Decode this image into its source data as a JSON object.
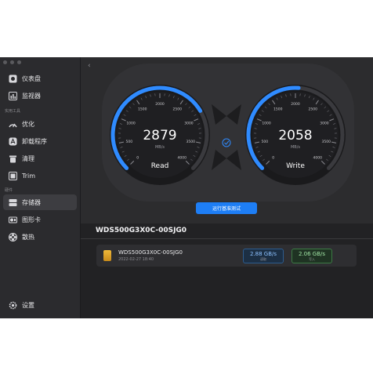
{
  "sidebar": {
    "items": [
      {
        "label": "仪表盘",
        "icon": "dashboard-icon"
      },
      {
        "label": "监视器",
        "icon": "monitor-icon"
      }
    ],
    "section_tools": "实用工具",
    "tools": [
      {
        "label": "优化",
        "icon": "optimize-icon"
      },
      {
        "label": "卸载程序",
        "icon": "uninstall-icon"
      },
      {
        "label": "清理",
        "icon": "trash-icon"
      },
      {
        "label": "Trim",
        "icon": "trim-icon"
      }
    ],
    "section_hardware": "硬件",
    "hardware": [
      {
        "label": "存储器",
        "icon": "storage-icon",
        "active": true
      },
      {
        "label": "图形卡",
        "icon": "gpu-icon"
      },
      {
        "label": "散热",
        "icon": "fan-icon"
      }
    ],
    "settings": {
      "label": "设置",
      "icon": "gear-icon"
    }
  },
  "main": {
    "back_symbol": "‹",
    "read": {
      "value": "2879",
      "unit": "MB/s",
      "label": "Read",
      "ticks": [
        "0",
        "500",
        "1000",
        "1500",
        "2000",
        "2500",
        "3000",
        "3500",
        "4000"
      ],
      "max": 4000
    },
    "write": {
      "value": "2058",
      "unit": "MB/s",
      "label": "Write",
      "ticks": [
        "0",
        "500",
        "1000",
        "1500",
        "2000",
        "2500",
        "3000",
        "3500",
        "4000"
      ],
      "max": 4000
    },
    "run_button": "运行基准测试",
    "disk_title": "WDS500G3X0C-00SJG0",
    "disk": {
      "name": "WDS500G3X0C-00SJG0",
      "date": "2022-02-27 18:40",
      "read_value": "2.88 GB/s",
      "read_sub": "读取",
      "write_value": "2.06 GB/s",
      "write_sub": "写入"
    }
  },
  "colors": {
    "accent": "#1e7ef5",
    "arc": "#2f8bff",
    "bg": "#2a2a2c"
  }
}
